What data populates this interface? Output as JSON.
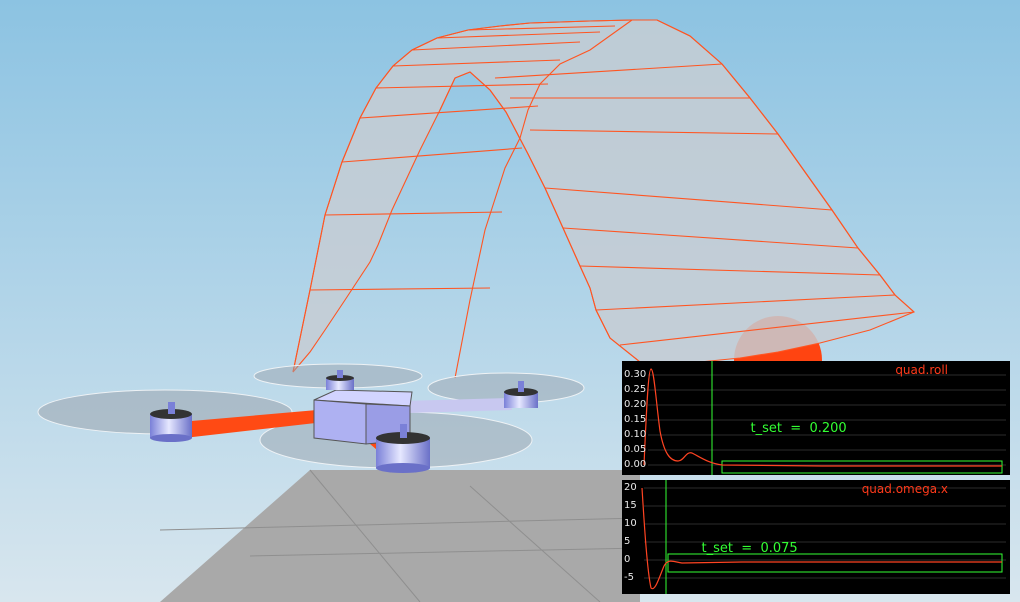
{
  "scene": {
    "sky_top": "#8fc4e2",
    "sky_bottom": "#cfe3ee",
    "floor_color": "#a8a8a8",
    "trajectory_color": "#ff5522",
    "target_color": "#ff4411",
    "drone_body_color": "#b0b4f4",
    "rotor_disc_color": "#9aa4ad"
  },
  "plots": [
    {
      "title": "quad.roll",
      "t_set_label": "t_set",
      "t_set_eq": "=",
      "t_set_value": "0.200",
      "y_ticks": [
        "0.30",
        "0.25",
        "0.20",
        "0.15",
        "0.10",
        "0.05",
        "0.00"
      ],
      "line_color": "#ff4422",
      "marker_color": "#33ff33"
    },
    {
      "title": "quad.omega.x",
      "t_set_label": "t_set",
      "t_set_eq": "=",
      "t_set_value": "0.075",
      "y_ticks": [
        "20",
        "15",
        "10",
        "5",
        "0",
        "-5"
      ],
      "line_color": "#ff4422",
      "marker_color": "#33ff33"
    }
  ]
}
